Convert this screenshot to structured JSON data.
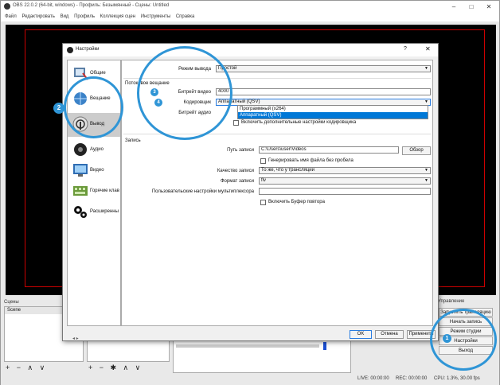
{
  "obs": {
    "title": "OBS 22.0.2 (64-bit, windows) - Профиль: Безымянный - Сцены: Untitled",
    "menu": [
      "Файл",
      "Редактировать",
      "Вид",
      "Профиль",
      "Коллекция сцен",
      "Инструменты",
      "Справка"
    ],
    "docks": {
      "scenes_label": "Сцены",
      "scene_item": "Scene",
      "controls_label": "Управление"
    },
    "controls": [
      "Запустить трансляцию",
      "Начать запись",
      "Режим студии",
      "Настройки",
      "Выход"
    ],
    "status": {
      "live": "LIVE: 00:00:00",
      "rec": "REC: 00:00:00",
      "cpu": "CPU: 1.3%, 30.00 fps"
    }
  },
  "dialog": {
    "title": "Настройки",
    "help": "?",
    "close": "✕",
    "categories": [
      "Общие",
      "Вещание",
      "Вывод",
      "Аудио",
      "Видео",
      "Горячие клав",
      "Расширенны"
    ],
    "selected_category": "Вывод",
    "output_mode_label": "Режим вывода",
    "output_mode_value": "Простой",
    "streaming_section": "Потоковое вещание",
    "video_bitrate_label": "Битрейт видео",
    "video_bitrate_value": "4000",
    "encoder_label": "Кодировщик",
    "encoder_value": "Аппаратный (QSV)",
    "encoder_options": [
      "Программный (x264)",
      "Аппаратный (QSV)"
    ],
    "audio_bitrate_label": "Битрейт аудио",
    "advanced_encoder_check": "Включить дополнительные настройки кодировщика",
    "recording_section": "Запись",
    "rec_path_label": "Путь записи",
    "rec_path_value": "C:\\Users\\user\\Videos",
    "browse": "Обзор",
    "gen_filename_check": "Генерировать имя файла без пробела",
    "rec_quality_label": "Качество записи",
    "rec_quality_value": "То же, что у трансляции",
    "rec_format_label": "Формат записи",
    "rec_format_value": "flv",
    "muxer_label": "Пользовательские настройки мультиплексора",
    "replay_buffer_check": "Включить Буфер повтора",
    "ok": "OK",
    "cancel": "Отмена",
    "apply": "Применить"
  },
  "annotations": {
    "colors": {
      "ring": "#2f95d6"
    },
    "badges": [
      "1",
      "2",
      "3",
      "4"
    ]
  }
}
